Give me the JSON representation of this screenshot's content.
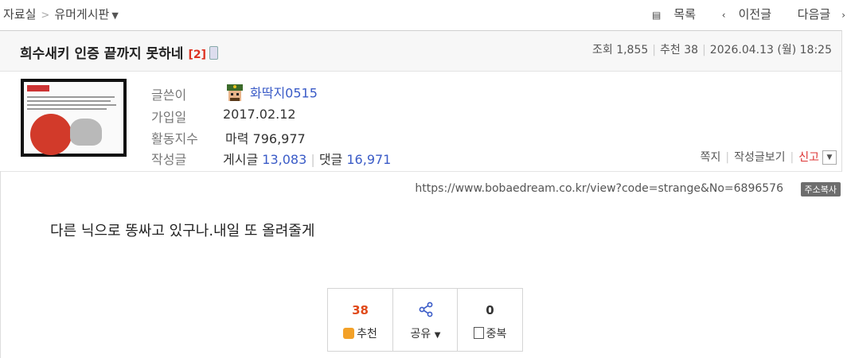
{
  "breadcrumb": {
    "home": "자료실",
    "separator": ">",
    "board": "유머게시판"
  },
  "topnav": {
    "list": "목록",
    "prev": "이전글",
    "next": "다음글"
  },
  "post": {
    "title": "희수새키 인증 끝까지 못하네",
    "comment_count": "[2]",
    "views_label": "조회",
    "views": "1,855",
    "recommend_label": "추천",
    "recommend": "38",
    "date": "2026.04.13 (월) 18:25"
  },
  "author": {
    "writer_label": "글쓴이",
    "writer": "화딱지0515",
    "joined_label": "가입일",
    "joined": "2017.02.12",
    "activity_label": "활동지수",
    "activity": "마력 796,977",
    "posts_label": "작성글",
    "posts_text": "게시글",
    "posts_count": "13,083",
    "comments_text": "댓글",
    "comments_count": "16,971"
  },
  "profile_actions": {
    "message": "쪽지",
    "view_posts": "작성글보기",
    "report": "신고"
  },
  "url": {
    "text": "https://www.bobaedream.co.kr/view?code=strange&No=6896576",
    "copy": "주소복사"
  },
  "content": {
    "text": "다른 닉으로  똥싸고 있구나.내일 또 올려줄게"
  },
  "votes": {
    "recommend_count": "38",
    "recommend_label": "추천",
    "share_label": "공유",
    "duplicate_count": "0",
    "duplicate_label": "중복"
  },
  "colors": {
    "accent_red": "#e04a1a",
    "link_blue": "#3a5bc7",
    "thumb": "#f3a128"
  }
}
